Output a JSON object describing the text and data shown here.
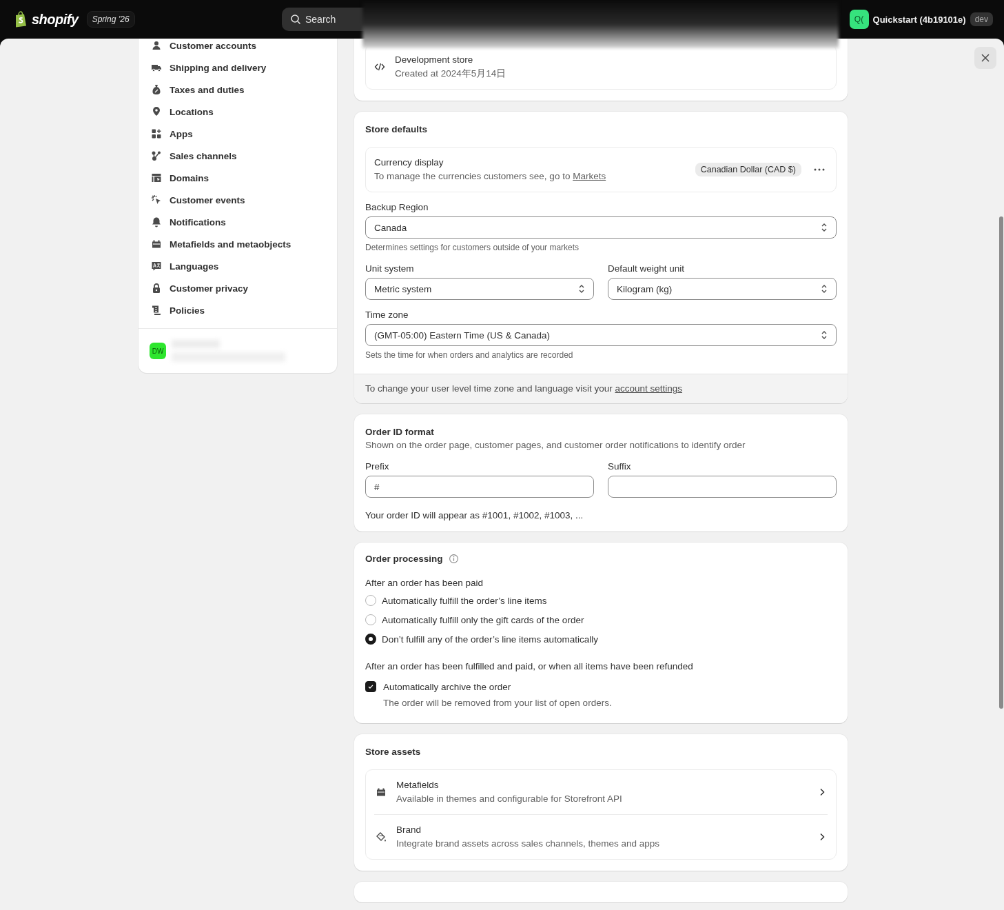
{
  "topbar": {
    "brand": "shopify",
    "edition": "Spring ’26",
    "search": {
      "placeholder": "Search"
    },
    "store": {
      "initials": "Q(",
      "name": "Quickstart (4b19101e)",
      "badge": "dev"
    }
  },
  "sidebar": {
    "items": [
      {
        "label": "Customer accounts",
        "kind": "person"
      },
      {
        "label": "Shipping and delivery",
        "kind": "truck"
      },
      {
        "label": "Taxes and duties",
        "kind": "bag"
      },
      {
        "label": "Locations",
        "kind": "pin"
      },
      {
        "label": "Apps",
        "kind": "apps"
      },
      {
        "label": "Sales channels",
        "kind": "channels"
      },
      {
        "label": "Domains",
        "kind": "domains"
      },
      {
        "label": "Customer events",
        "kind": "cursor"
      },
      {
        "label": "Notifications",
        "kind": "bell"
      },
      {
        "label": "Metafields and metaobjects",
        "kind": "meta"
      },
      {
        "label": "Languages",
        "kind": "lang"
      },
      {
        "label": "Customer privacy",
        "kind": "lock"
      },
      {
        "label": "Policies",
        "kind": "policy"
      }
    ],
    "user": {
      "initials": "DW"
    }
  },
  "store_info": {
    "title": "Development store",
    "subtitle": "Created at 2024年5月14日"
  },
  "store_defaults": {
    "title": "Store defaults",
    "currency": {
      "title": "Currency display",
      "text": "To manage the currencies customers see, go to ",
      "link": "Markets",
      "badge": "Canadian Dollar (CAD $)"
    },
    "backup_region": {
      "label": "Backup Region",
      "value": "Canada",
      "help": "Determines settings for customers outside of your markets"
    },
    "unit_system": {
      "label": "Unit system",
      "value": "Metric system"
    },
    "weight_unit": {
      "label": "Default weight unit",
      "value": "Kilogram (kg)"
    },
    "time_zone": {
      "label": "Time zone",
      "value": "(GMT-05:00) Eastern Time (US & Canada)",
      "help": "Sets the time for when orders and analytics are recorded"
    },
    "footer": {
      "text": "To change your user level time zone and language visit your ",
      "link": "account settings"
    }
  },
  "order_id": {
    "title": "Order ID format",
    "subtitle": "Shown on the order page, customer pages, and customer order notifications to identify order",
    "prefix": {
      "label": "Prefix",
      "value": "#"
    },
    "suffix": {
      "label": "Suffix"
    },
    "preview": "Your order ID will appear as #1001, #1002, #1003, ..."
  },
  "order_processing": {
    "title": "Order processing",
    "paid_label": "After an order has been paid",
    "options": [
      {
        "label": "Automatically fulfill the order’s line items",
        "selected": false
      },
      {
        "label": "Automatically fulfill only the gift cards of the order",
        "selected": false
      },
      {
        "label": "Don’t fulfill any of the order’s line items automatically",
        "selected": true
      }
    ],
    "fulfilled_label": "After an order has been fulfilled and paid, or when all items have been refunded",
    "archive": {
      "label": "Automatically archive the order",
      "checked": true,
      "help": "The order will be removed from your list of open orders."
    }
  },
  "store_assets": {
    "title": "Store assets",
    "items": [
      {
        "title": "Metafields",
        "subtitle": "Available in themes and configurable for Storefront API",
        "kind": "meta"
      },
      {
        "title": "Brand",
        "subtitle": "Integrate brand assets across sales channels, themes and apps",
        "kind": "brand"
      }
    ]
  }
}
